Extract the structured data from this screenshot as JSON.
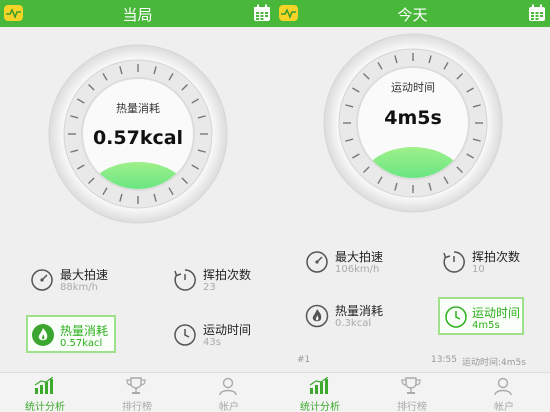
{
  "left": {
    "title": "当局",
    "gauge": {
      "label": "热量消耗",
      "value": "0.57kcal"
    },
    "stats": [
      {
        "label": "最大拍速",
        "value": "88km/h",
        "icon": "speedometer-icon"
      },
      {
        "label": "挥拍次数",
        "value": "23",
        "icon": "swing-count-icon"
      },
      {
        "label": "热量消耗",
        "value": "0.57kacl",
        "icon": "flame-icon",
        "active": true
      },
      {
        "label": "运动时间",
        "value": "43s",
        "icon": "clock-icon"
      }
    ]
  },
  "right": {
    "title": "今天",
    "gauge": {
      "label": "运动时间",
      "value": "4m5s"
    },
    "stats": [
      {
        "label": "最大拍速",
        "value": "106km/h",
        "icon": "speedometer-icon"
      },
      {
        "label": "挥拍次数",
        "value": "10",
        "icon": "swing-count-icon"
      },
      {
        "label": "热量消耗",
        "value": "0.3kcal",
        "icon": "flame-icon"
      },
      {
        "label": "运动时间",
        "value": "4m5s",
        "icon": "clock-icon",
        "active": true
      }
    ],
    "record": {
      "index": "#1",
      "time": "13:55",
      "duration": "运动时间:4m5s"
    }
  },
  "tabs": [
    {
      "label": "统计分析",
      "icon": "bar-chart-icon",
      "active": true
    },
    {
      "label": "排行榜",
      "icon": "trophy-icon",
      "active": false
    },
    {
      "label": "帐户",
      "icon": "user-icon",
      "active": false
    }
  ],
  "colors": {
    "brand": "#48b73a",
    "accent": "#2db01d",
    "highlight_border": "#9fe08a"
  }
}
